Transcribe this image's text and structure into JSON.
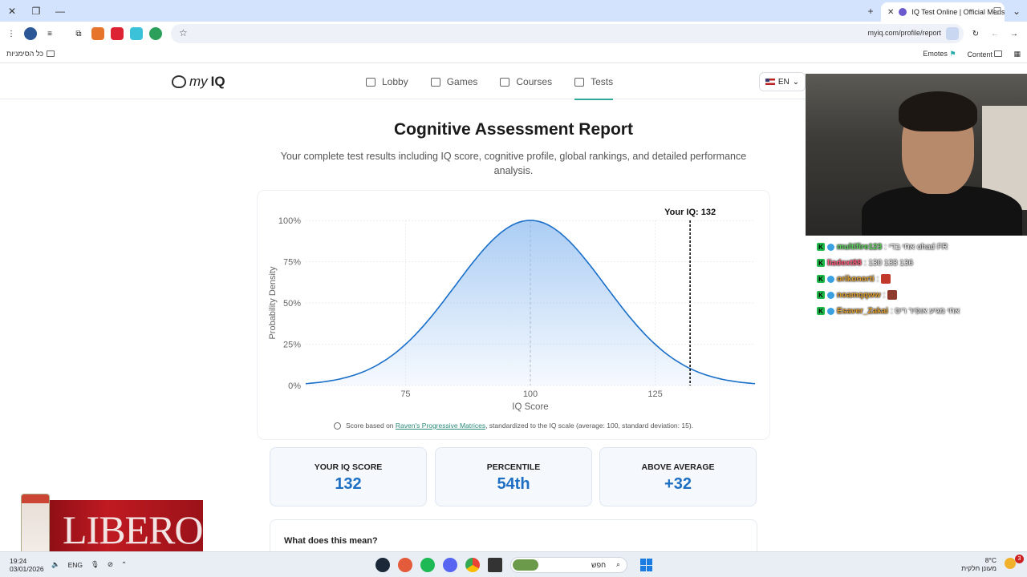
{
  "browser": {
    "tab_title": "IQ Test Online | Official Mensa-",
    "url": "myiq.com/profile/report",
    "bookmarks_all": "כל הסימניות",
    "bookmark_emotes": "Emotes",
    "bookmark_content": "Content"
  },
  "site": {
    "logo_my": "my",
    "logo_iq": "IQ",
    "nav": [
      {
        "label": "Lobby"
      },
      {
        "label": "Games"
      },
      {
        "label": "Courses"
      },
      {
        "label": "Tests"
      }
    ],
    "language": "EN"
  },
  "report": {
    "title": "Cognitive Assessment Report",
    "subtitle": "Your complete test results including IQ score, cognitive profile, global rankings, and detailed performance analysis.",
    "note_prefix": "Score based on",
    "note_link": "Raven's Progressive Matrices",
    "note_suffix": ", standardized to the IQ scale (average: 100, standard deviation: 15).",
    "stats": [
      {
        "label": "YOUR IQ SCORE",
        "value": "132"
      },
      {
        "label": "PERCENTILE",
        "value": "54th"
      },
      {
        "label": "ABOVE AVERAGE",
        "value": "+32"
      }
    ],
    "meaning_heading": "What does this mean?"
  },
  "chart_data": {
    "type": "area",
    "mean": 100,
    "sd": 15,
    "x_range": [
      55,
      145
    ],
    "x_ticks": [
      75,
      100,
      125
    ],
    "y_ticks": [
      "0%",
      "25%",
      "50%",
      "75%",
      "100%"
    ],
    "ylim": [
      0,
      100
    ],
    "xlabel": "IQ Score",
    "ylabel": "Probability Density",
    "marker_value": 132,
    "marker_label": "Your IQ: 132",
    "grid": true,
    "line_color": "#1a6fc9",
    "fill_color": "#8fbcf0"
  },
  "chat": [
    {
      "user": "multifire123",
      "msg": ": אחי בדי ohad FR",
      "color": "#5fd35f"
    },
    {
      "user": "liadext88",
      "msg": ": 130 133 136",
      "color": "#ff5a7a"
    },
    {
      "user": "orikonorti",
      "msg": ":",
      "color": "#e0a030"
    },
    {
      "user": "noamqqww",
      "msg": ":",
      "color": "#e0a030"
    },
    {
      "user": "Esaver_Zakai",
      "msg": ": אחי מגיע אופיר ריס",
      "color": "#e0a030"
    }
  ],
  "ad": {
    "brand": "LIBERO"
  },
  "taskbar": {
    "time": "19:24",
    "date": "03/01/2026",
    "lang": "ENG",
    "search_placeholder": "חפש",
    "temperature": "8°C",
    "weather_desc": "מעונן חלקית",
    "notif_count": "3"
  }
}
